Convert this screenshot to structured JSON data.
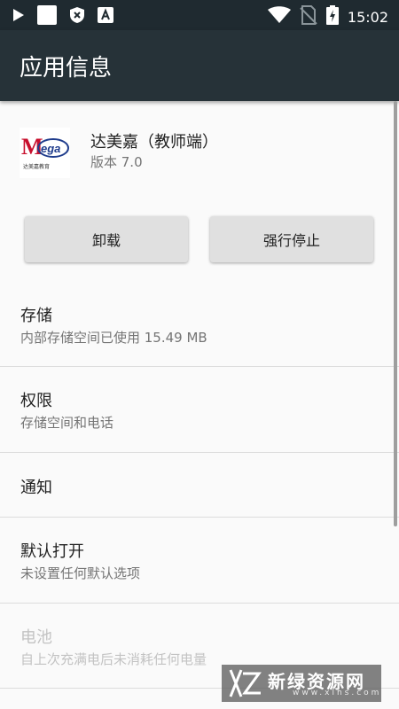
{
  "status_bar": {
    "time": "15:02",
    "icons": [
      "play-icon",
      "notification-square-icon",
      "shield-x-icon",
      "font-a-icon",
      "wifi-icon",
      "no-sim-icon",
      "battery-charging-icon"
    ]
  },
  "app_bar": {
    "title": "应用信息"
  },
  "app": {
    "logo_text": "Mega",
    "logo_caption": "达美嘉教育",
    "name": "达美嘉（教师端）",
    "version": "版本 7.0"
  },
  "buttons": {
    "uninstall": "卸载",
    "force_stop": "强行停止"
  },
  "settings": [
    {
      "title": "存储",
      "subtitle": "内部存储空间已使用 15.49 MB",
      "enabled": true
    },
    {
      "title": "权限",
      "subtitle": "存储空间和电话",
      "enabled": true
    },
    {
      "title": "通知",
      "subtitle": "",
      "enabled": true
    },
    {
      "title": "默认打开",
      "subtitle": "未设置任何默认选项",
      "enabled": true
    },
    {
      "title": "电池",
      "subtitle": "自上次充满电后未消耗任何电量",
      "enabled": false
    }
  ],
  "watermark": {
    "title": "新绿资源网",
    "url": "www.xlhs.com"
  },
  "colors": {
    "app_bar": "#263238",
    "status_bar": "#1f2a30",
    "background": "#fafafa",
    "button": "#e0e0e0"
  }
}
